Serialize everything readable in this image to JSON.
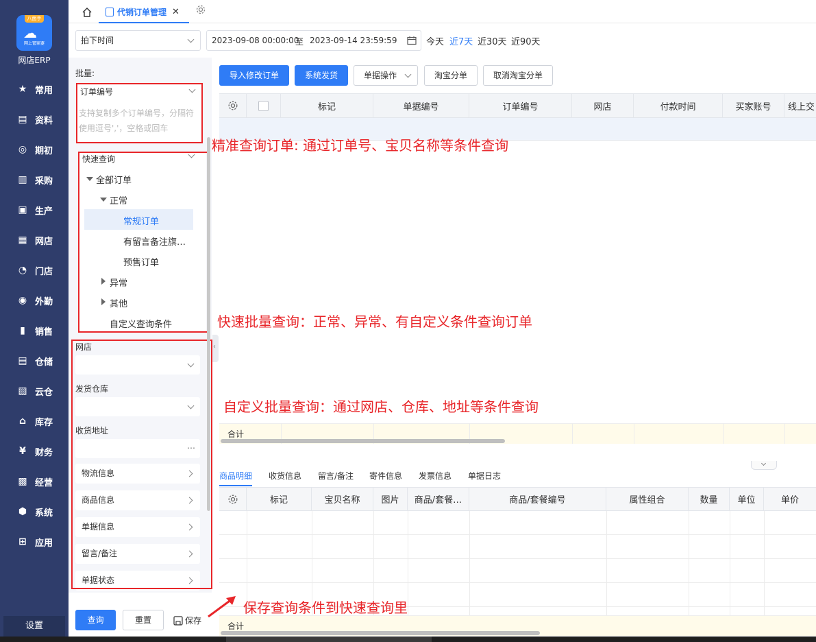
{
  "sidebar": {
    "logo_tag": "八面手",
    "logo_sub": "网上管家婆",
    "brand": "网店ERP",
    "items": [
      {
        "label": "常用",
        "icon": "star-icon"
      },
      {
        "label": "资料",
        "icon": "archive-icon"
      },
      {
        "label": "期初",
        "icon": "target-icon"
      },
      {
        "label": "采购",
        "icon": "purchase-icon"
      },
      {
        "label": "生产",
        "icon": "production-icon"
      },
      {
        "label": "网店",
        "icon": "store-icon"
      },
      {
        "label": "门店",
        "icon": "pie-icon"
      },
      {
        "label": "外勤",
        "icon": "field-icon"
      },
      {
        "label": "销售",
        "icon": "sales-chart-icon"
      },
      {
        "label": "仓储",
        "icon": "warehouse-icon"
      },
      {
        "label": "云仓",
        "icon": "cloud-warehouse-icon"
      },
      {
        "label": "库存",
        "icon": "inventory-icon"
      },
      {
        "label": "财务",
        "icon": "finance-icon"
      },
      {
        "label": "经营",
        "icon": "operation-icon"
      },
      {
        "label": "系统",
        "icon": "system-icon"
      },
      {
        "label": "应用",
        "icon": "apps-icon"
      }
    ],
    "settings": "设置"
  },
  "tabs": {
    "active": "代销订单管理"
  },
  "filter": {
    "time_type": "拍下时间",
    "date_start": "2023-09-08 00:00:00",
    "date_sep": "至",
    "date_end": "2023-09-14 23:59:59",
    "quick": [
      "今天",
      "近7天",
      "近30天",
      "近90天"
    ],
    "quick_active": "近7天"
  },
  "left": {
    "batch_label": "批量:",
    "order_no_select": "订单编号",
    "order_no_placeholder": "支持复制多个订单编号，分隔符使用逗号','，空格或回车",
    "quick_query": "快速查询",
    "tree": {
      "all": "全部订单",
      "normal": "正常",
      "regular": "常规订单",
      "remark": "有留言备注旗…",
      "presale": "预售订单",
      "abnormal": "异常",
      "other": "其他",
      "custom": "自定义查询条件"
    },
    "shop_label": "网店",
    "warehouse_label": "发货仓库",
    "address_label": "收货地址",
    "address_more": "…",
    "groups": [
      "物流信息",
      "商品信息",
      "单据信息",
      "留言/备注",
      "单据状态"
    ],
    "query_btn": "查询",
    "reset_btn": "重置",
    "save_btn": "保存"
  },
  "toolbar": {
    "import": "导入修改订单",
    "ship": "系统发货",
    "doc_ops": "单据操作",
    "taobao_split": "淘宝分单",
    "cancel_split": "取消淘宝分单"
  },
  "main_grid": {
    "headers": [
      "标记",
      "单据编号",
      "订单编号",
      "网店",
      "付款时间",
      "买家账号",
      "线上交"
    ],
    "sum_label": "合计"
  },
  "detail_tabs": [
    "商品明细",
    "收货信息",
    "留言/备注",
    "寄件信息",
    "发票信息",
    "单据日志"
  ],
  "detail_grid": {
    "headers": [
      "标记",
      "宝贝名称",
      "图片",
      "商品/套餐…",
      "商品/套餐编号",
      "属性组合",
      "数量",
      "单位",
      "单价"
    ],
    "sum_label": "合计"
  },
  "annotations": {
    "a1": "精准查询订单: 通过订单号、宝贝名称等条件查询",
    "a2": "快速批量查询：正常、异常、有自定义条件查询订单",
    "a3": "自定义批量查询：通过网店、仓库、地址等条件查询",
    "a4": "保存查询条件到快速查询里"
  },
  "colors": {
    "sidebar": "#2f3d6b",
    "accent": "#2f7cf6",
    "annotation": "#e8262a"
  }
}
